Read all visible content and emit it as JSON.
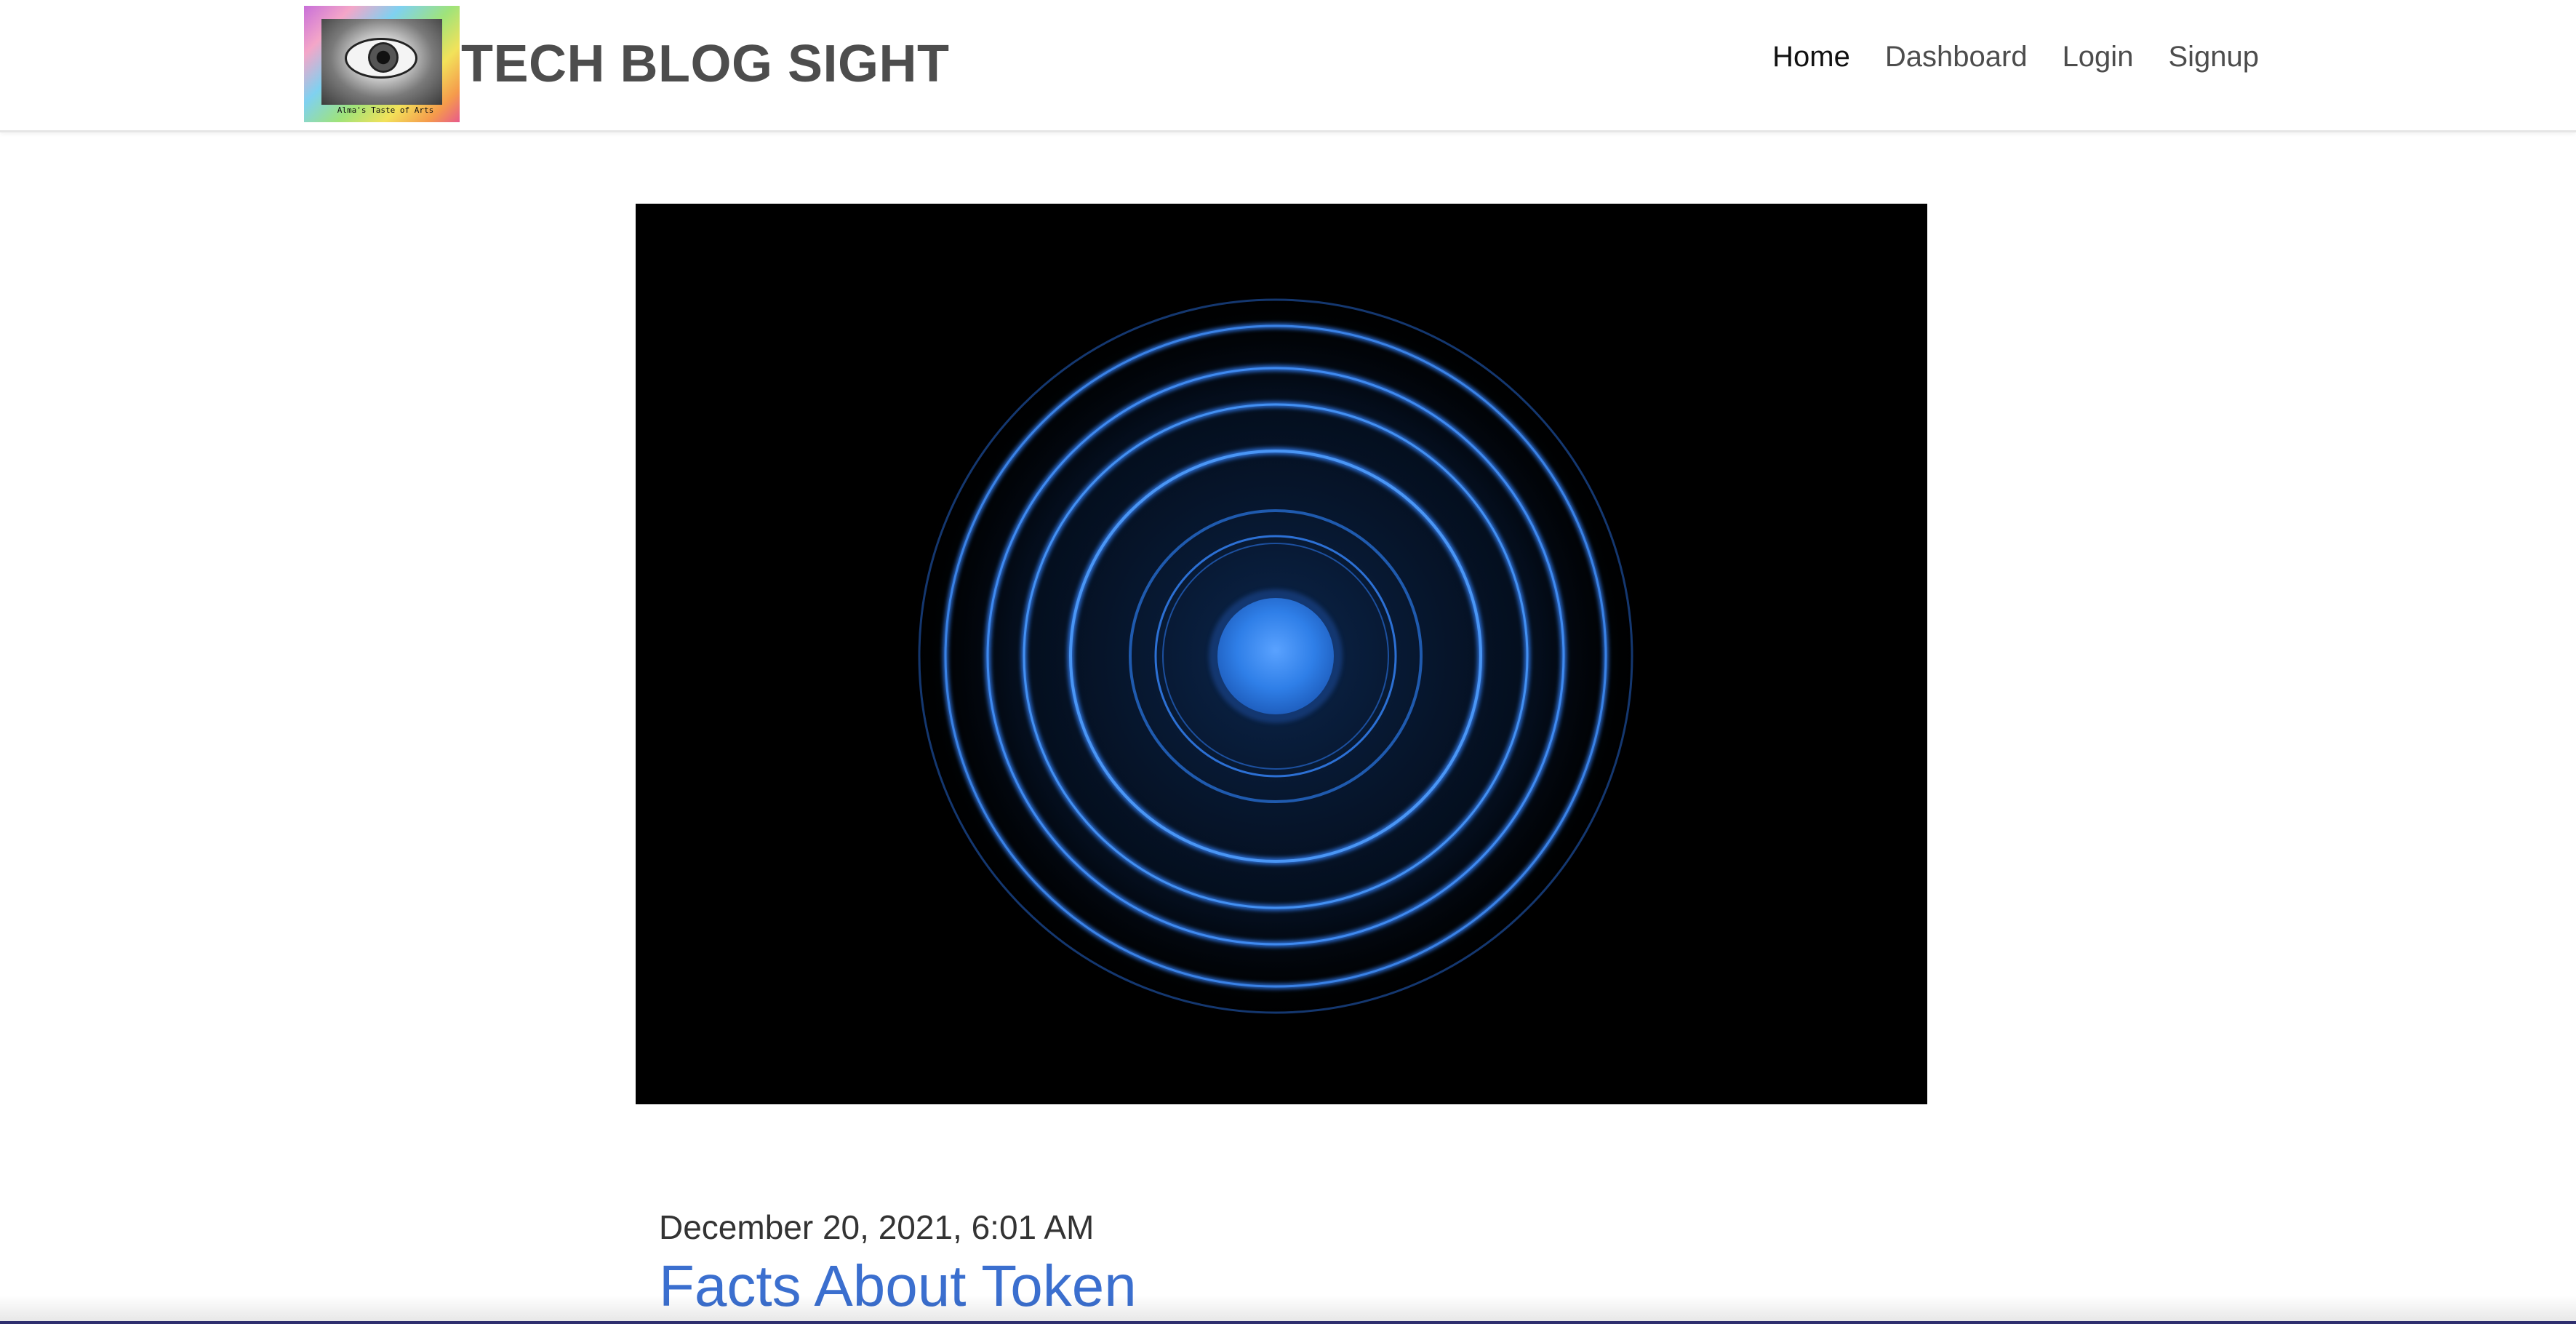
{
  "header": {
    "site_title": "TECH BLOG SIGHT",
    "logo_caption": "Alma's Taste of Arts",
    "nav": [
      {
        "label": "Home",
        "active": true
      },
      {
        "label": "Dashboard",
        "active": false
      },
      {
        "label": "Login",
        "active": false
      },
      {
        "label": "Signup",
        "active": false
      }
    ]
  },
  "post": {
    "image_description_icon": "concentric-blue-rings-image",
    "date": "December 20, 2021, 6:01 AM",
    "title": "Facts About Token"
  },
  "colors": {
    "title_link": "#3b6fcf",
    "ring_blue": "#3a82e6",
    "hero_bg": "#000000",
    "nav_text": "#4d4d4d",
    "nav_active": "#111111"
  }
}
